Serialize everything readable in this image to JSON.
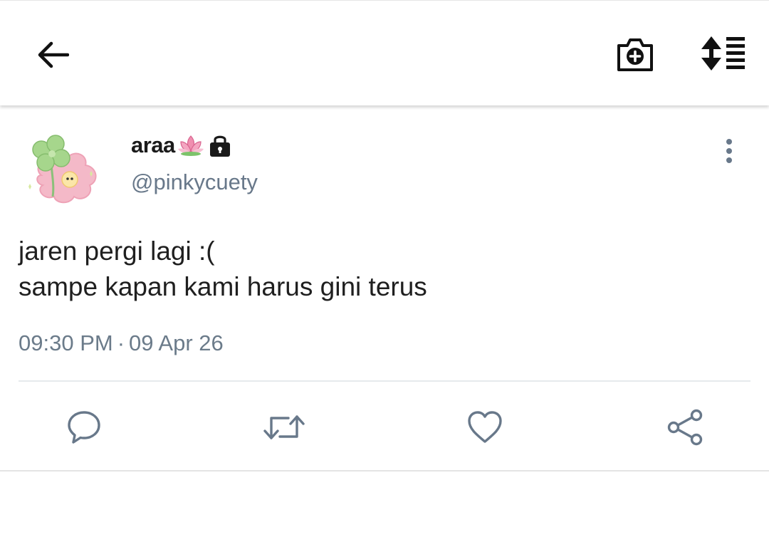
{
  "appbar": {
    "back_icon": "arrow-left-icon",
    "camera_icon": "camera-add-icon",
    "sort_icon": "sort-list-icon"
  },
  "tweet": {
    "author": {
      "display_name": "araa",
      "name_emoji": "lotus-icon",
      "protected_icon": "lock-icon",
      "handle": "@pinkycuety"
    },
    "more_icon": "more-vertical-icon",
    "text_lines": [
      "jaren pergi lagi :(",
      "sampe kapan kami harus gini terus"
    ],
    "time": "09:30 PM",
    "separator": "·",
    "date": "09 Apr 26",
    "actions": {
      "reply_icon": "reply-icon",
      "retweet_icon": "retweet-icon",
      "like_icon": "heart-icon",
      "share_icon": "share-icon"
    }
  },
  "colors": {
    "text_primary": "#1a1a1a",
    "text_secondary": "#68788a",
    "icon_gray": "#68788a",
    "divider": "#e6eaed"
  }
}
